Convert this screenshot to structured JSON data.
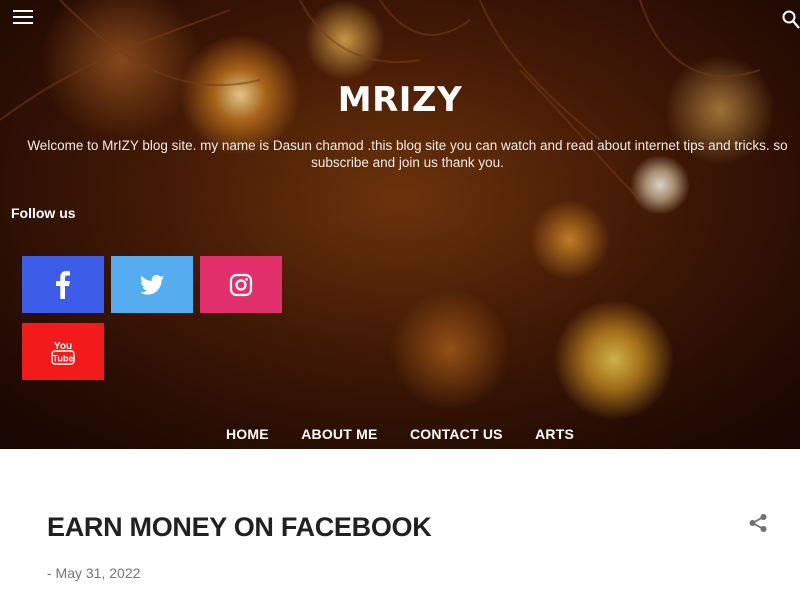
{
  "header": {
    "menu_icon": "hamburger-menu-icon",
    "search_icon": "search-icon",
    "title": "MRIZY",
    "description": "Welcome to MrIZY blog site. my name is Dasun chamod .this blog site you can watch and read about internet tips and tricks. so subscribe and join us thank you."
  },
  "follow": {
    "title": "Follow us",
    "links": [
      {
        "name": "facebook",
        "icon": "facebook-icon",
        "color": "#3b5de7"
      },
      {
        "name": "twitter",
        "icon": "twitter-icon",
        "color": "#55acee"
      },
      {
        "name": "instagram",
        "icon": "instagram-icon",
        "color": "#e1306c"
      },
      {
        "name": "youtube",
        "icon": "youtube-icon",
        "color": "#f21a1a"
      }
    ]
  },
  "nav": {
    "items": [
      "HOME",
      "ABOUT ME",
      "CONTACT US",
      "ARTS"
    ]
  },
  "post": {
    "title": "EARN MONEY ON FACEBOOK",
    "date": "- May 31, 2022",
    "share_icon": "share-icon"
  }
}
